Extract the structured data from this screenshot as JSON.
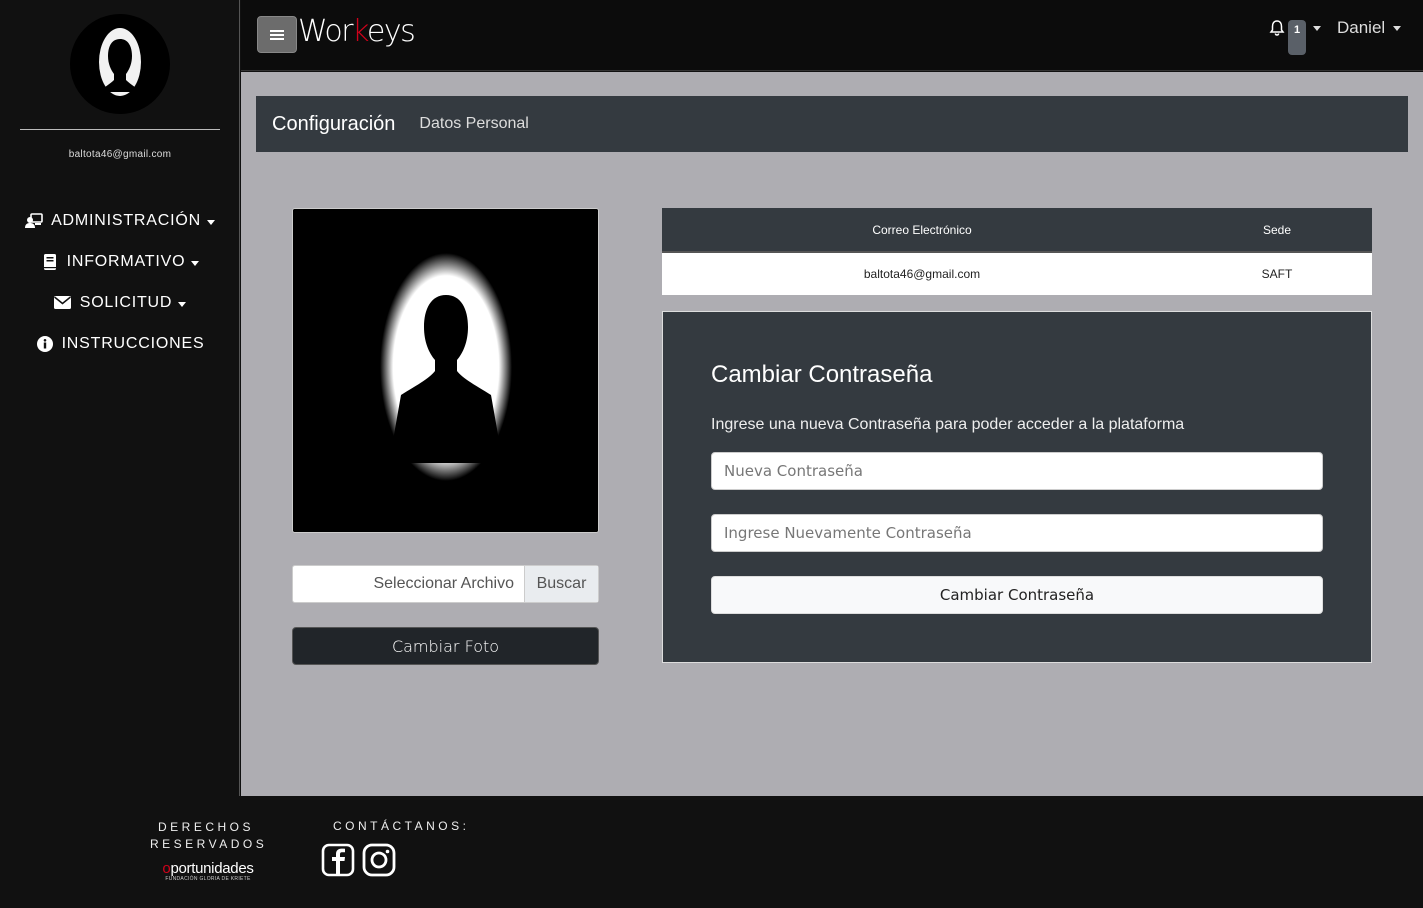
{
  "sidebar": {
    "email": "baltota46@gmail.com",
    "items": [
      {
        "label": "ADMINISTRACIÓN",
        "icon": "user-tie-icon"
      },
      {
        "label": "INFORMATIVO",
        "icon": "book-icon"
      },
      {
        "label": "SOLICITUD",
        "icon": "envelope-icon"
      },
      {
        "label": "INSTRUCCIONES",
        "icon": "info-circle-icon"
      }
    ]
  },
  "topbar": {
    "brand_pre": "Wor",
    "brand_k": "k",
    "brand_post": "eys",
    "notification_count": "1",
    "user": "Daniel"
  },
  "subheader": {
    "title": "Configuración",
    "link": "Datos Personal"
  },
  "photo": {
    "file_label": "Seleccionar Archivo",
    "browse_label": "Buscar",
    "change_button": "Cambiar Foto"
  },
  "info_table": {
    "headers": [
      "Correo Electrónico",
      "Sede"
    ],
    "rows": [
      [
        "baltota46@gmail.com",
        "SAFT"
      ]
    ]
  },
  "password": {
    "title": "Cambiar Contraseña",
    "description": "Ingrese una nueva Contraseña para poder acceder a la plataforma",
    "new_placeholder": "Nueva Contraseña",
    "confirm_placeholder": "Ingrese Nuevamente Contraseña",
    "submit_label": "Cambiar Contraseña"
  },
  "footer": {
    "rights_line1": "DERECHOS",
    "rights_line2": "RESERVADOS",
    "org_name_o": "o",
    "org_name_rest": "portunidades",
    "org_sub": "FUNDACIÓN GLORIA DE KRIETE",
    "contact_label": "CONTÁCTANOS:",
    "social_icons": [
      "facebook-icon",
      "instagram-icon"
    ]
  },
  "colors": {
    "accent_red": "#d0021b",
    "panel_dark": "#343a40",
    "main_bg": "#aeadb2"
  }
}
